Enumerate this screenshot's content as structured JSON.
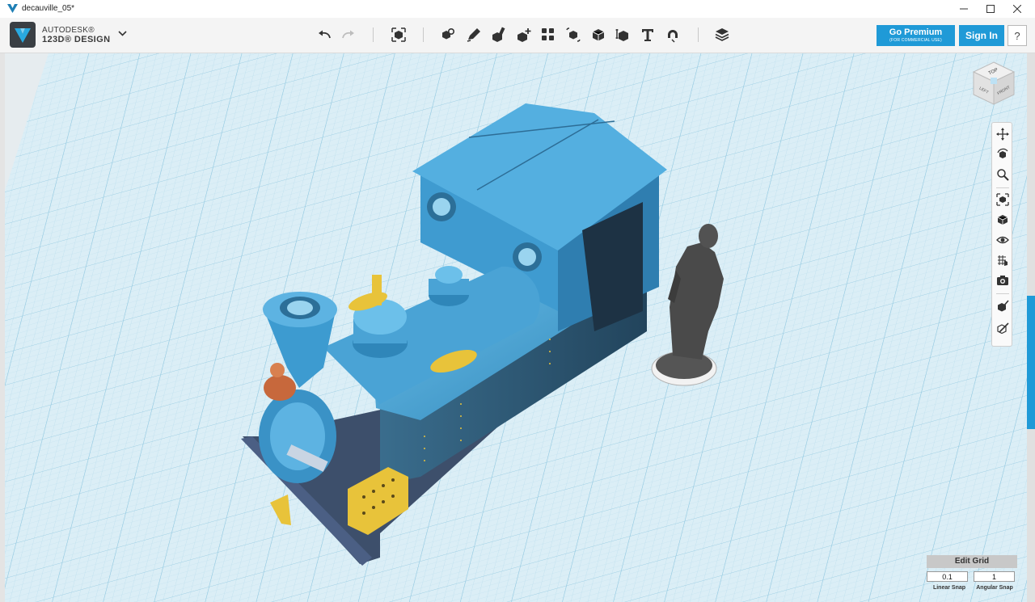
{
  "window": {
    "title": "decauville_05*"
  },
  "app": {
    "brand_line1": "AUTODESK®",
    "brand_line2": "123D® DESIGN"
  },
  "header": {
    "premium_label": "Go Premium",
    "premium_sub": "(FOR COMMERCIAL USE)",
    "signin_label": "Sign In",
    "help_label": "?"
  },
  "viewcube": {
    "top": "TOP",
    "left": "LEFT",
    "front": "FRONT"
  },
  "edit_grid": {
    "title": "Edit Grid",
    "linear_value": "0.1",
    "angular_value": "1",
    "linear_label": "Linear Snap",
    "angular_label": "Angular Snap"
  },
  "colors": {
    "accent": "#1f9ad7",
    "grid_bg": "#dbeef6",
    "model_body": "#4fa8d8",
    "brass": "#e8c33a",
    "copper": "#c7683c",
    "figure": "#4a4a4a"
  }
}
